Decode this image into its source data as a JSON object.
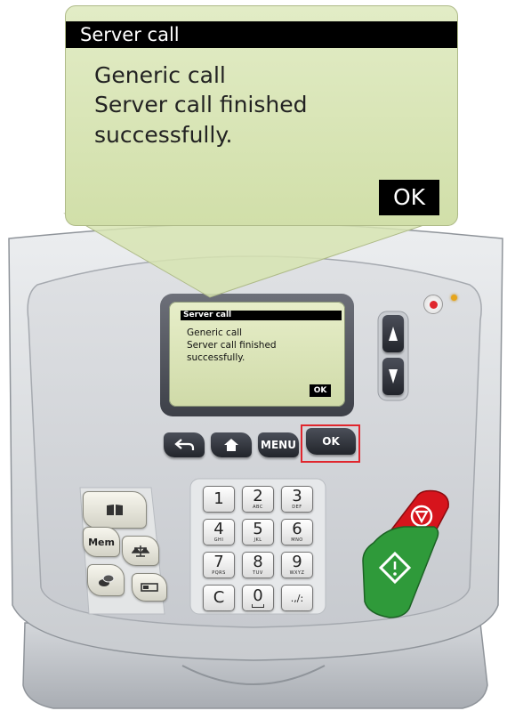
{
  "callout": {
    "title": "Server call",
    "lines": [
      "Generic call",
      "Server call finished",
      "successfully."
    ],
    "ok_label": "OK"
  },
  "device_screen": {
    "title": "Server call",
    "lines": [
      "Generic call",
      "Server call finished",
      "successfully."
    ],
    "ok_label": "OK"
  },
  "nav_buttons": {
    "menu_label": "MENU",
    "ok_label": "OK"
  },
  "function_keys": {
    "mem_label": "Mem"
  },
  "keypad": {
    "keys": [
      {
        "digit": "1",
        "letters": ""
      },
      {
        "digit": "2",
        "letters": "ABC"
      },
      {
        "digit": "3",
        "letters": "DEF"
      },
      {
        "digit": "4",
        "letters": "GHI"
      },
      {
        "digit": "5",
        "letters": "JKL"
      },
      {
        "digit": "6",
        "letters": "MNO"
      },
      {
        "digit": "7",
        "letters": "PQRS"
      },
      {
        "digit": "8",
        "letters": "TUV"
      },
      {
        "digit": "9",
        "letters": "WXYZ"
      },
      {
        "digit": "C",
        "letters": ""
      },
      {
        "digit": "0",
        "letters": ""
      },
      {
        "digit": ".,/:",
        "letters": ""
      }
    ]
  },
  "colors": {
    "stop_button": "#d6141c",
    "start_button": "#2f9a3a",
    "highlight": "#e0262d",
    "power_led": "#e0262d",
    "status_led": "#e6a51c"
  }
}
